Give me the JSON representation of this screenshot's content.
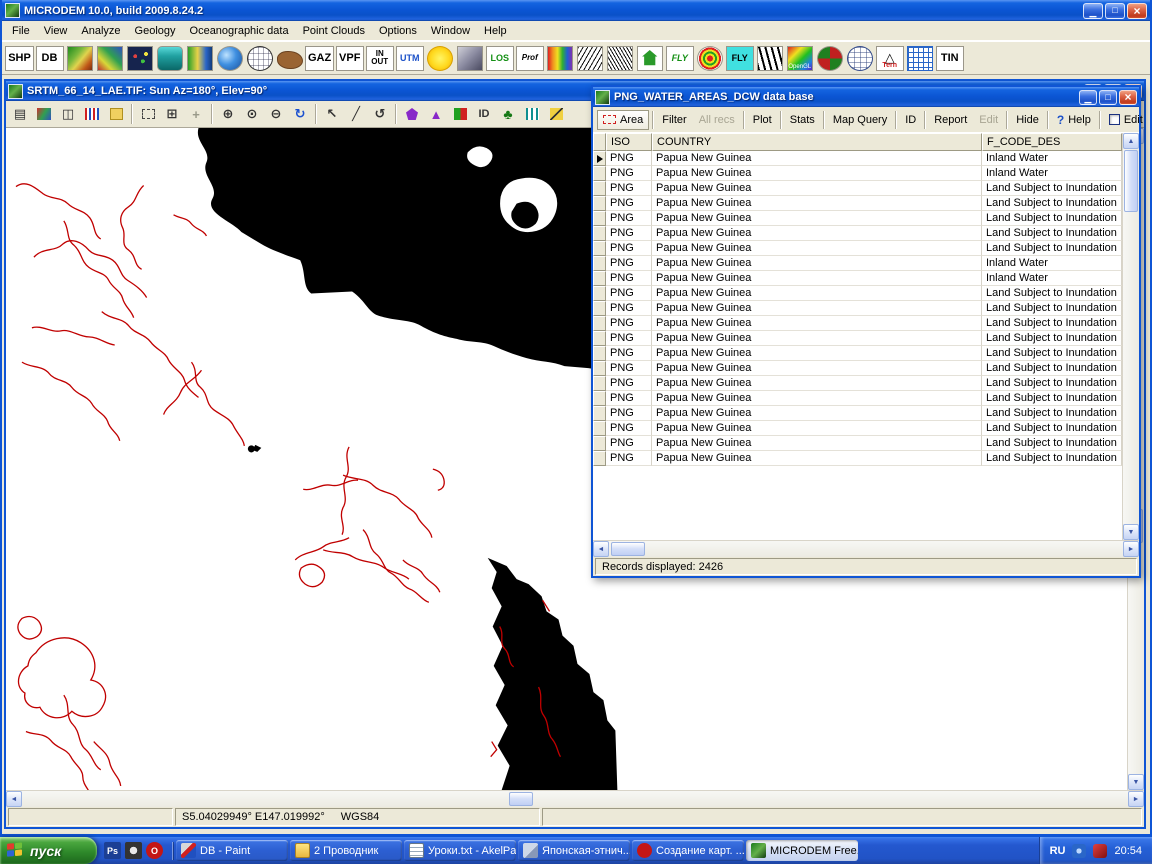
{
  "app": {
    "title": "MICRODEM 10.0, build 2009.8.24.2",
    "menus": [
      "File",
      "View",
      "Analyze",
      "Geology",
      "Oceanographic data",
      "Point Clouds",
      "Options",
      "Window",
      "Help"
    ]
  },
  "main_toolbar": {
    "shp": "SHP",
    "db": "DB",
    "gaz": "GAZ",
    "vpf": "VPF",
    "in": "IN",
    "out": "OUT",
    "utm": "UTM",
    "los": "LOS",
    "prof": "Prof",
    "fly_green": "FLY",
    "fly_cyan": "FLY",
    "opengl": "OpenGL",
    "tern": "Tern",
    "tin": "TIN"
  },
  "map_window": {
    "title": "SRTM_66_14_LAE.TIF: Sun Az=180°, Elev=90°",
    "id_tool": "ID",
    "status_coords": "S5.04029949° E147.019992°",
    "status_datum": "WGS84"
  },
  "db_window": {
    "title": "PNG_WATER_AREAS_DCW data base",
    "buttons": {
      "area": "Area",
      "filter": "Filter",
      "all_recs": "All recs",
      "plot": "Plot",
      "stats": "Stats",
      "map_query": "Map Query",
      "id": "ID",
      "report": "Report",
      "edit": "Edit",
      "hide": "Hide",
      "help": "Help",
      "edit_check": "Edit"
    },
    "columns": [
      "ISO",
      "COUNTRY",
      "F_CODE_DES"
    ],
    "rows": [
      {
        "iso": "PNG",
        "country": "Papua New Guinea",
        "f_code_des": "Inland Water"
      },
      {
        "iso": "PNG",
        "country": "Papua New Guinea",
        "f_code_des": "Inland Water"
      },
      {
        "iso": "PNG",
        "country": "Papua New Guinea",
        "f_code_des": "Land Subject to Inundation"
      },
      {
        "iso": "PNG",
        "country": "Papua New Guinea",
        "f_code_des": "Land Subject to Inundation"
      },
      {
        "iso": "PNG",
        "country": "Papua New Guinea",
        "f_code_des": "Land Subject to Inundation"
      },
      {
        "iso": "PNG",
        "country": "Papua New Guinea",
        "f_code_des": "Land Subject to Inundation"
      },
      {
        "iso": "PNG",
        "country": "Papua New Guinea",
        "f_code_des": "Land Subject to Inundation"
      },
      {
        "iso": "PNG",
        "country": "Papua New Guinea",
        "f_code_des": "Inland Water"
      },
      {
        "iso": "PNG",
        "country": "Papua New Guinea",
        "f_code_des": "Inland Water"
      },
      {
        "iso": "PNG",
        "country": "Papua New Guinea",
        "f_code_des": "Land Subject to Inundation"
      },
      {
        "iso": "PNG",
        "country": "Papua New Guinea",
        "f_code_des": "Land Subject to Inundation"
      },
      {
        "iso": "PNG",
        "country": "Papua New Guinea",
        "f_code_des": "Land Subject to Inundation"
      },
      {
        "iso": "PNG",
        "country": "Papua New Guinea",
        "f_code_des": "Land Subject to Inundation"
      },
      {
        "iso": "PNG",
        "country": "Papua New Guinea",
        "f_code_des": "Land Subject to Inundation"
      },
      {
        "iso": "PNG",
        "country": "Papua New Guinea",
        "f_code_des": "Land Subject to Inundation"
      },
      {
        "iso": "PNG",
        "country": "Papua New Guinea",
        "f_code_des": "Land Subject to Inundation"
      },
      {
        "iso": "PNG",
        "country": "Papua New Guinea",
        "f_code_des": "Land Subject to Inundation"
      },
      {
        "iso": "PNG",
        "country": "Papua New Guinea",
        "f_code_des": "Land Subject to Inundation"
      },
      {
        "iso": "PNG",
        "country": "Papua New Guinea",
        "f_code_des": "Land Subject to Inundation"
      },
      {
        "iso": "PNG",
        "country": "Papua New Guinea",
        "f_code_des": "Land Subject to Inundation"
      },
      {
        "iso": "PNG",
        "country": "Papua New Guinea",
        "f_code_des": "Land Subject to Inundation"
      }
    ],
    "status": "Records displayed: 2426"
  },
  "taskbar": {
    "start": "пуск",
    "buttons": [
      {
        "label": "DB - Paint"
      },
      {
        "label": "2 Проводник"
      },
      {
        "label": "Уроки.txt - AkelPad"
      },
      {
        "label": "Японская-этнич..."
      },
      {
        "label": "Создание карт. ..."
      },
      {
        "label": "MICRODEM Free..."
      }
    ],
    "language": "RU",
    "clock": "20:54"
  },
  "icons": {
    "minimize": "▁",
    "maximize": "□",
    "close": "×",
    "help_q": "?",
    "up": "▲",
    "down": "▼",
    "left": "◄",
    "right": "►",
    "print": "▤",
    "copy": "◫",
    "grid": "⊞",
    "pan": "+",
    "zoom_in": "⊕",
    "zoom_box": "⊙",
    "zoom_out": "⊖",
    "refresh": "↻",
    "rotate": "↺",
    "select": "↖",
    "line": "╱",
    "mountain": "▲",
    "tree": "♣",
    "triangle": "△",
    "photoshop": "Ps",
    "opera": "O"
  },
  "colors": {
    "title_blue": "#0b55d4",
    "taskbar_blue": "#2458cf",
    "start_green": "#2f8a2b",
    "hydro_red": "#c00000"
  }
}
